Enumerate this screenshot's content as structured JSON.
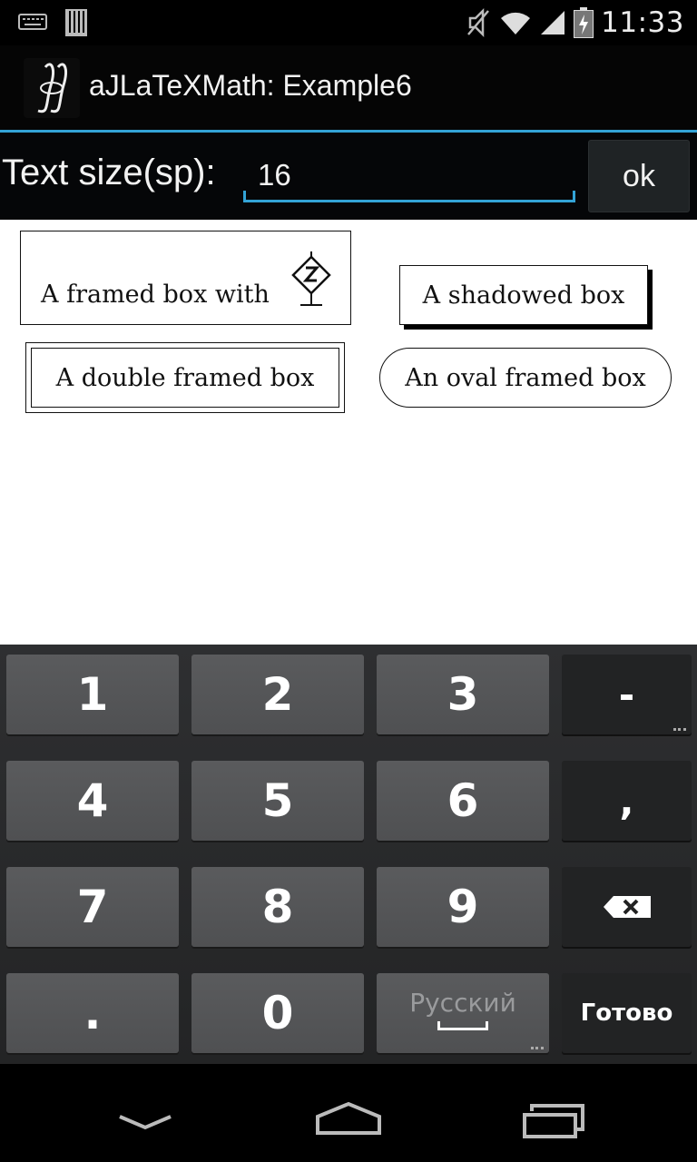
{
  "status_bar": {
    "time": "11:33",
    "icons": [
      "keyboard-icon",
      "sd-card-icon",
      "mute-icon",
      "wifi-icon",
      "signal-icon",
      "battery-icon"
    ]
  },
  "action_bar": {
    "title": "aJLaTeXMath: Example6",
    "icon": "integral-app-icon"
  },
  "input_row": {
    "label": "Text size(sp):",
    "value": "16",
    "ok_label": "ok"
  },
  "content": {
    "framed_box": "A framed box with",
    "shadowed_box": "A shadowed box",
    "double_framed_box": "A double framed box",
    "oval_framed_box": "An oval framed box"
  },
  "keyboard": {
    "rows": [
      [
        "1",
        "2",
        "3",
        "-"
      ],
      [
        "4",
        "5",
        "6",
        ","
      ],
      [
        "7",
        "8",
        "9",
        ""
      ],
      [
        ".",
        "0",
        "Русский",
        "Готово"
      ]
    ]
  },
  "nav_bar": {
    "icons": [
      "back-icon",
      "home-icon",
      "recents-icon"
    ]
  },
  "colors": {
    "accent": "#33a3d6",
    "background": "#000000",
    "content_bg": "#ffffff",
    "key": "#55565a",
    "key_fn": "#222324"
  }
}
